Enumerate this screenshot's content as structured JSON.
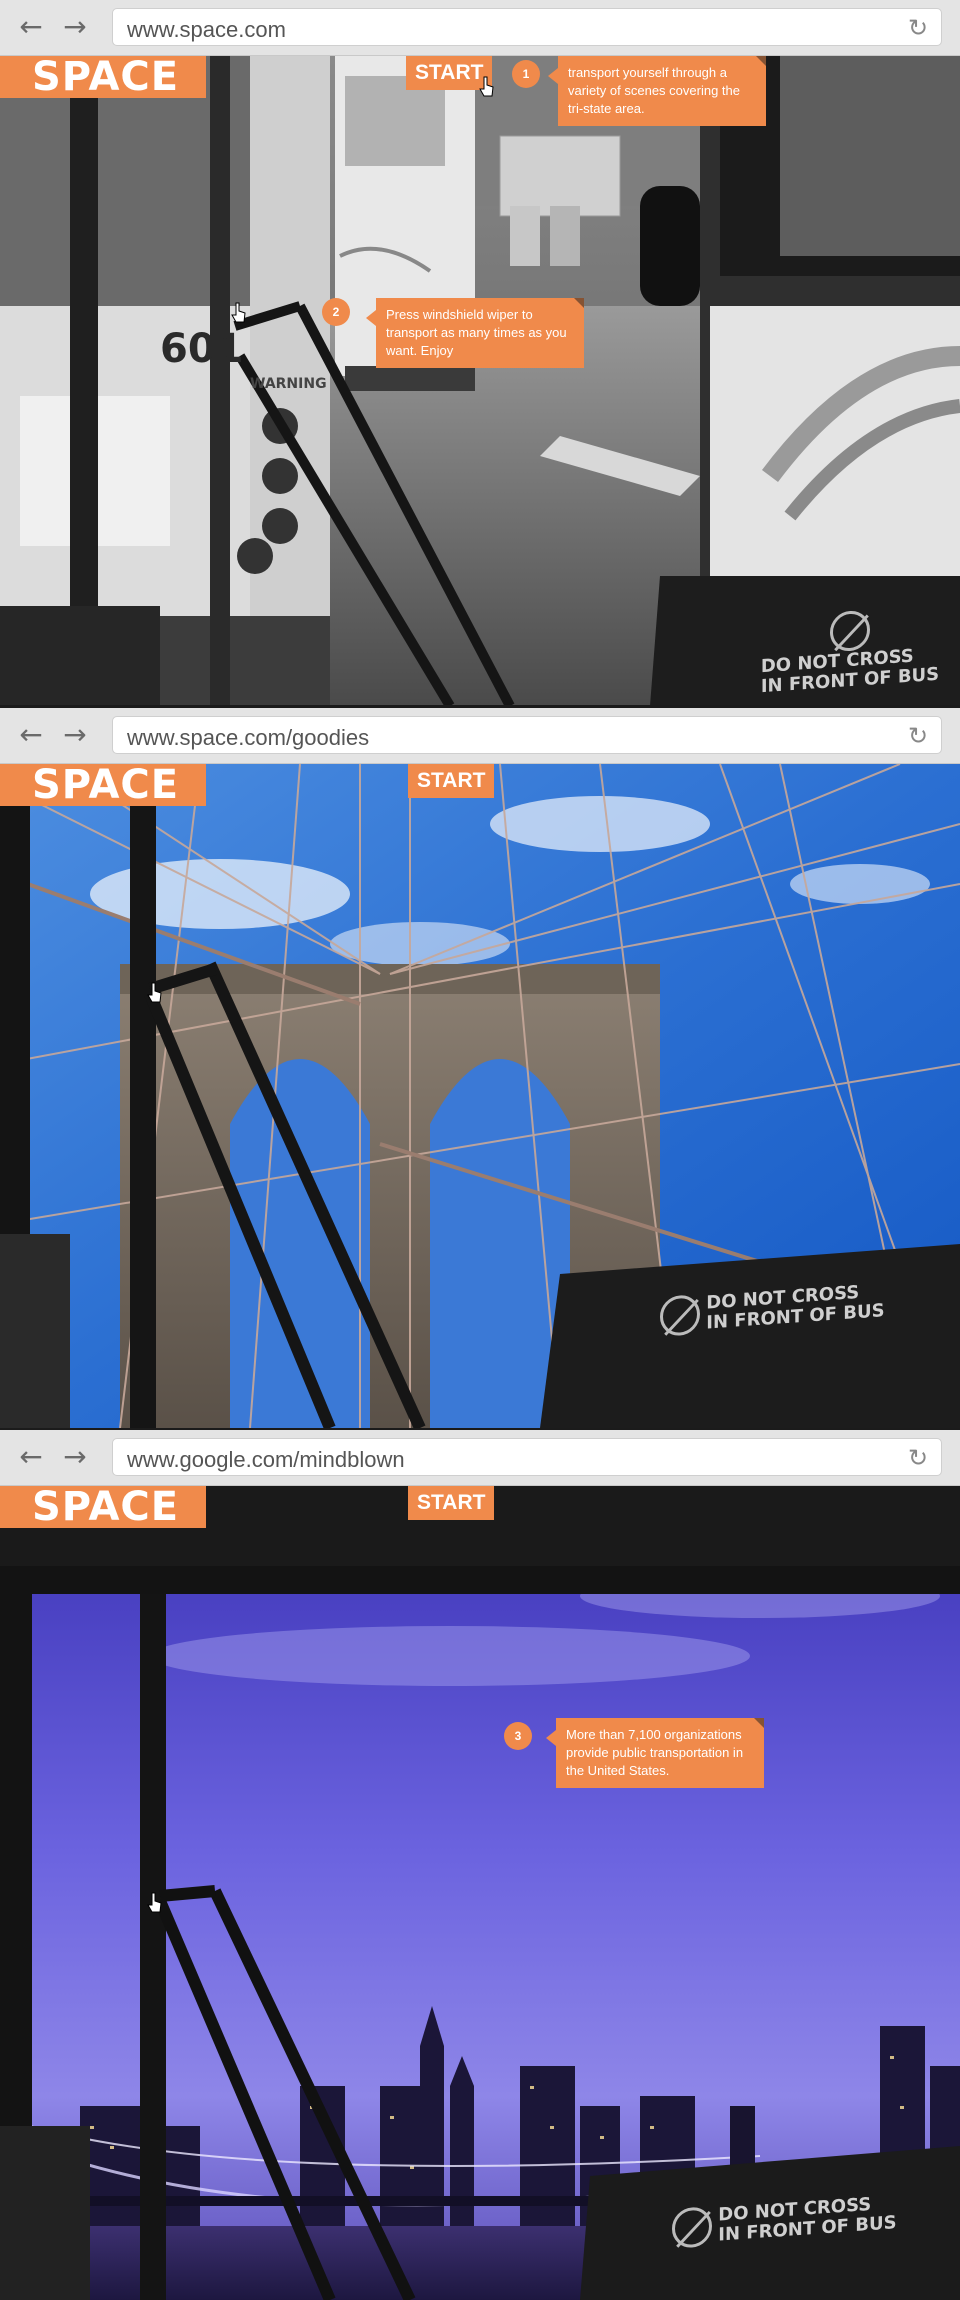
{
  "frames": [
    {
      "url": "www.space.com",
      "logo": "SPACE",
      "start_label": "START",
      "tips": [
        {
          "num": "1",
          "text": "transport yourself through a variety of scenes covering the tri-state area."
        },
        {
          "num": "2",
          "text": "Press windshield wiper to transport as many times as you want. Enjoy"
        }
      ],
      "sign_line1": "DO NOT CROSS",
      "sign_line2": "IN FRONT OF BUS",
      "bus_number": "601",
      "bus_warning": "WARNING"
    },
    {
      "url": "www.space.com/goodies",
      "logo": "SPACE",
      "start_label": "START",
      "sign_line1": "DO NOT CROSS",
      "sign_line2": "IN FRONT OF BUS"
    },
    {
      "url": "www.google.com/mindblown",
      "logo": "SPACE",
      "start_label": "START",
      "tips": [
        {
          "num": "3",
          "text": "More than 7,100 organizations provide public transportation in the United States."
        }
      ],
      "sign_line1": "DO NOT CROSS",
      "sign_line2": "IN FRONT OF BUS"
    }
  ],
  "icons": {
    "back": "arrow-left-icon",
    "forward": "arrow-right-icon",
    "reload": "reload-icon",
    "cursor": "hand-pointer-icon"
  },
  "colors": {
    "accent": "#f08a4b",
    "chrome": "#e4e4e4"
  }
}
